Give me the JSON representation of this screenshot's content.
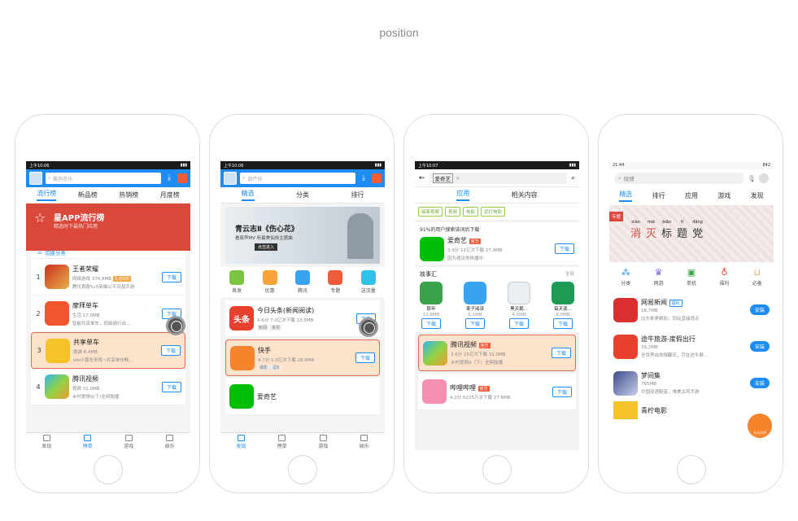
{
  "caption": "position",
  "phone1": {
    "status_time": "上午10:06",
    "search_placeholder": "酷狗音乐",
    "tabs": [
      "流行榜",
      "新品榜",
      "热销榜",
      "月度榜"
    ],
    "banner_title": "星APP流行榜",
    "banner_sub": "精选时下最热门应用",
    "switch_label": "切换分类",
    "apps": [
      {
        "rank": "1",
        "name": "王者荣耀",
        "meta": "网络游戏 374.8MB",
        "desc": "腾讯首款5v5英雄公平对战手游",
        "badge": "礼包9天",
        "btn": "下载"
      },
      {
        "rank": "2",
        "name": "摩拜单车",
        "meta": "生活 17.0MB",
        "desc": "智能共享单车，低碳骑行出...",
        "btn": "下载"
      },
      {
        "rank": "3",
        "name": "共享单车",
        "meta": "旅游 8.4MB",
        "desc": "ofo小黄车来啦~共享单车畅...",
        "btn": "下载"
      },
      {
        "rank": "4",
        "name": "腾讯视频",
        "meta": "视频 31.0MB",
        "desc": "乡村爱情9(下)全网独播",
        "btn": "下载"
      }
    ],
    "nav": [
      "发现",
      "榜单",
      "游戏",
      "娱乐"
    ]
  },
  "phone2": {
    "status_time": "上午10:06",
    "search_placeholder": "葫芦侠",
    "tabs": [
      "精选",
      "分类",
      "排行"
    ],
    "banner_title": "青云志Ⅱ《伤心花》",
    "banner_sub": "看原声MV 听最美仙侠主题曲",
    "banner_btn": "点击进入",
    "cats": [
      "首发",
      "优惠",
      "腾讯",
      "专题",
      "送流量"
    ],
    "apps": [
      {
        "name": "今日头条(新闻阅读)",
        "meta": "4.6分 7.0亿次下载 13.5MB",
        "tags": [
          "新闻",
          "资讯"
        ],
        "btn": "下载"
      },
      {
        "name": "快手",
        "meta": "4.7分 5.0亿次下载 28.9MB",
        "tags": [
          "摄影",
          "逗B"
        ],
        "btn": "下载"
      },
      {
        "name": "爱奇艺",
        "meta": "",
        "tags": [],
        "btn": ""
      }
    ],
    "nav": [
      "发现",
      "榜单",
      "游戏",
      "娱乐"
    ]
  },
  "phone3": {
    "status_time": "上午10:07",
    "search_value": "爱奇艺",
    "tabs": [
      "应用",
      "相关内容"
    ],
    "chips": [
      "搞笑视频",
      "视频",
      "电影",
      "武打电影"
    ],
    "section_hint": "91%的用户搜索该词后下载",
    "main_app": {
      "name": "爱奇艺",
      "badge": "官方",
      "meta": "3.9分 11亿次下载 27.9MB",
      "desc": "因为遇见你热播中",
      "btn": "下载"
    },
    "section_title": "故事汇",
    "section_more": "全部",
    "grid": [
      {
        "name": "那年",
        "size": "12.6MB",
        "btn": "下载"
      },
      {
        "name": "麦子阅读",
        "size": "6.1MB",
        "btn": "下载"
      },
      {
        "name": "黑天鹅...",
        "size": "4.6MB",
        "btn": "下载"
      },
      {
        "name": "每天读...",
        "size": "8.0MB",
        "btn": "下载"
      }
    ],
    "apps": [
      {
        "name": "腾讯视频",
        "badge": "官方",
        "meta": "3.6分 15亿次下载 31.0MB",
        "desc": "乡村爱情9（下）全网独播",
        "btn": "下载"
      },
      {
        "name": "哔哩哔哩",
        "badge": "官方",
        "meta": "4.2分 6225万次下载 27.6MB",
        "btn": "下载"
      }
    ]
  },
  "phone4": {
    "status_time": "21:44",
    "status_right": "842",
    "search_placeholder": "微博",
    "tabs": [
      "精选",
      "排行",
      "应用",
      "游戏",
      "发现"
    ],
    "banner_chars": [
      "消",
      "灭",
      "标",
      "题",
      "党"
    ],
    "banner_pinyin": [
      "xiāo",
      "miè",
      "biāo",
      "tí",
      "dǎng"
    ],
    "banner_tag": "专题",
    "cats": [
      "分类",
      "网游",
      "单机",
      "福利",
      "必备"
    ],
    "apps": [
      {
        "name": "网易新闻",
        "badge": "福利",
        "meta": "16.7MB",
        "desc": "比头条更精彩，同站直接观点",
        "btn": "安装"
      },
      {
        "name": "途牛旅游-度假出行",
        "meta": "39.2MB",
        "desc": "全世界由你嗨翻天，尽在途牛屏...",
        "btn": "安装"
      },
      {
        "name": "梦间集",
        "meta": "765MB",
        "desc": "中国双语配音，唯美古风手游",
        "btn": "安装"
      },
      {
        "name": "青柠电影",
        "meta": "",
        "desc": "",
        "btn": ""
      }
    ],
    "float_label": "大众点评"
  },
  "colors": {
    "accent": "#1e8cf0",
    "highlight_bg": "#fde3cc",
    "highlight_border": "#e36b4e",
    "red": "#d9483b"
  }
}
